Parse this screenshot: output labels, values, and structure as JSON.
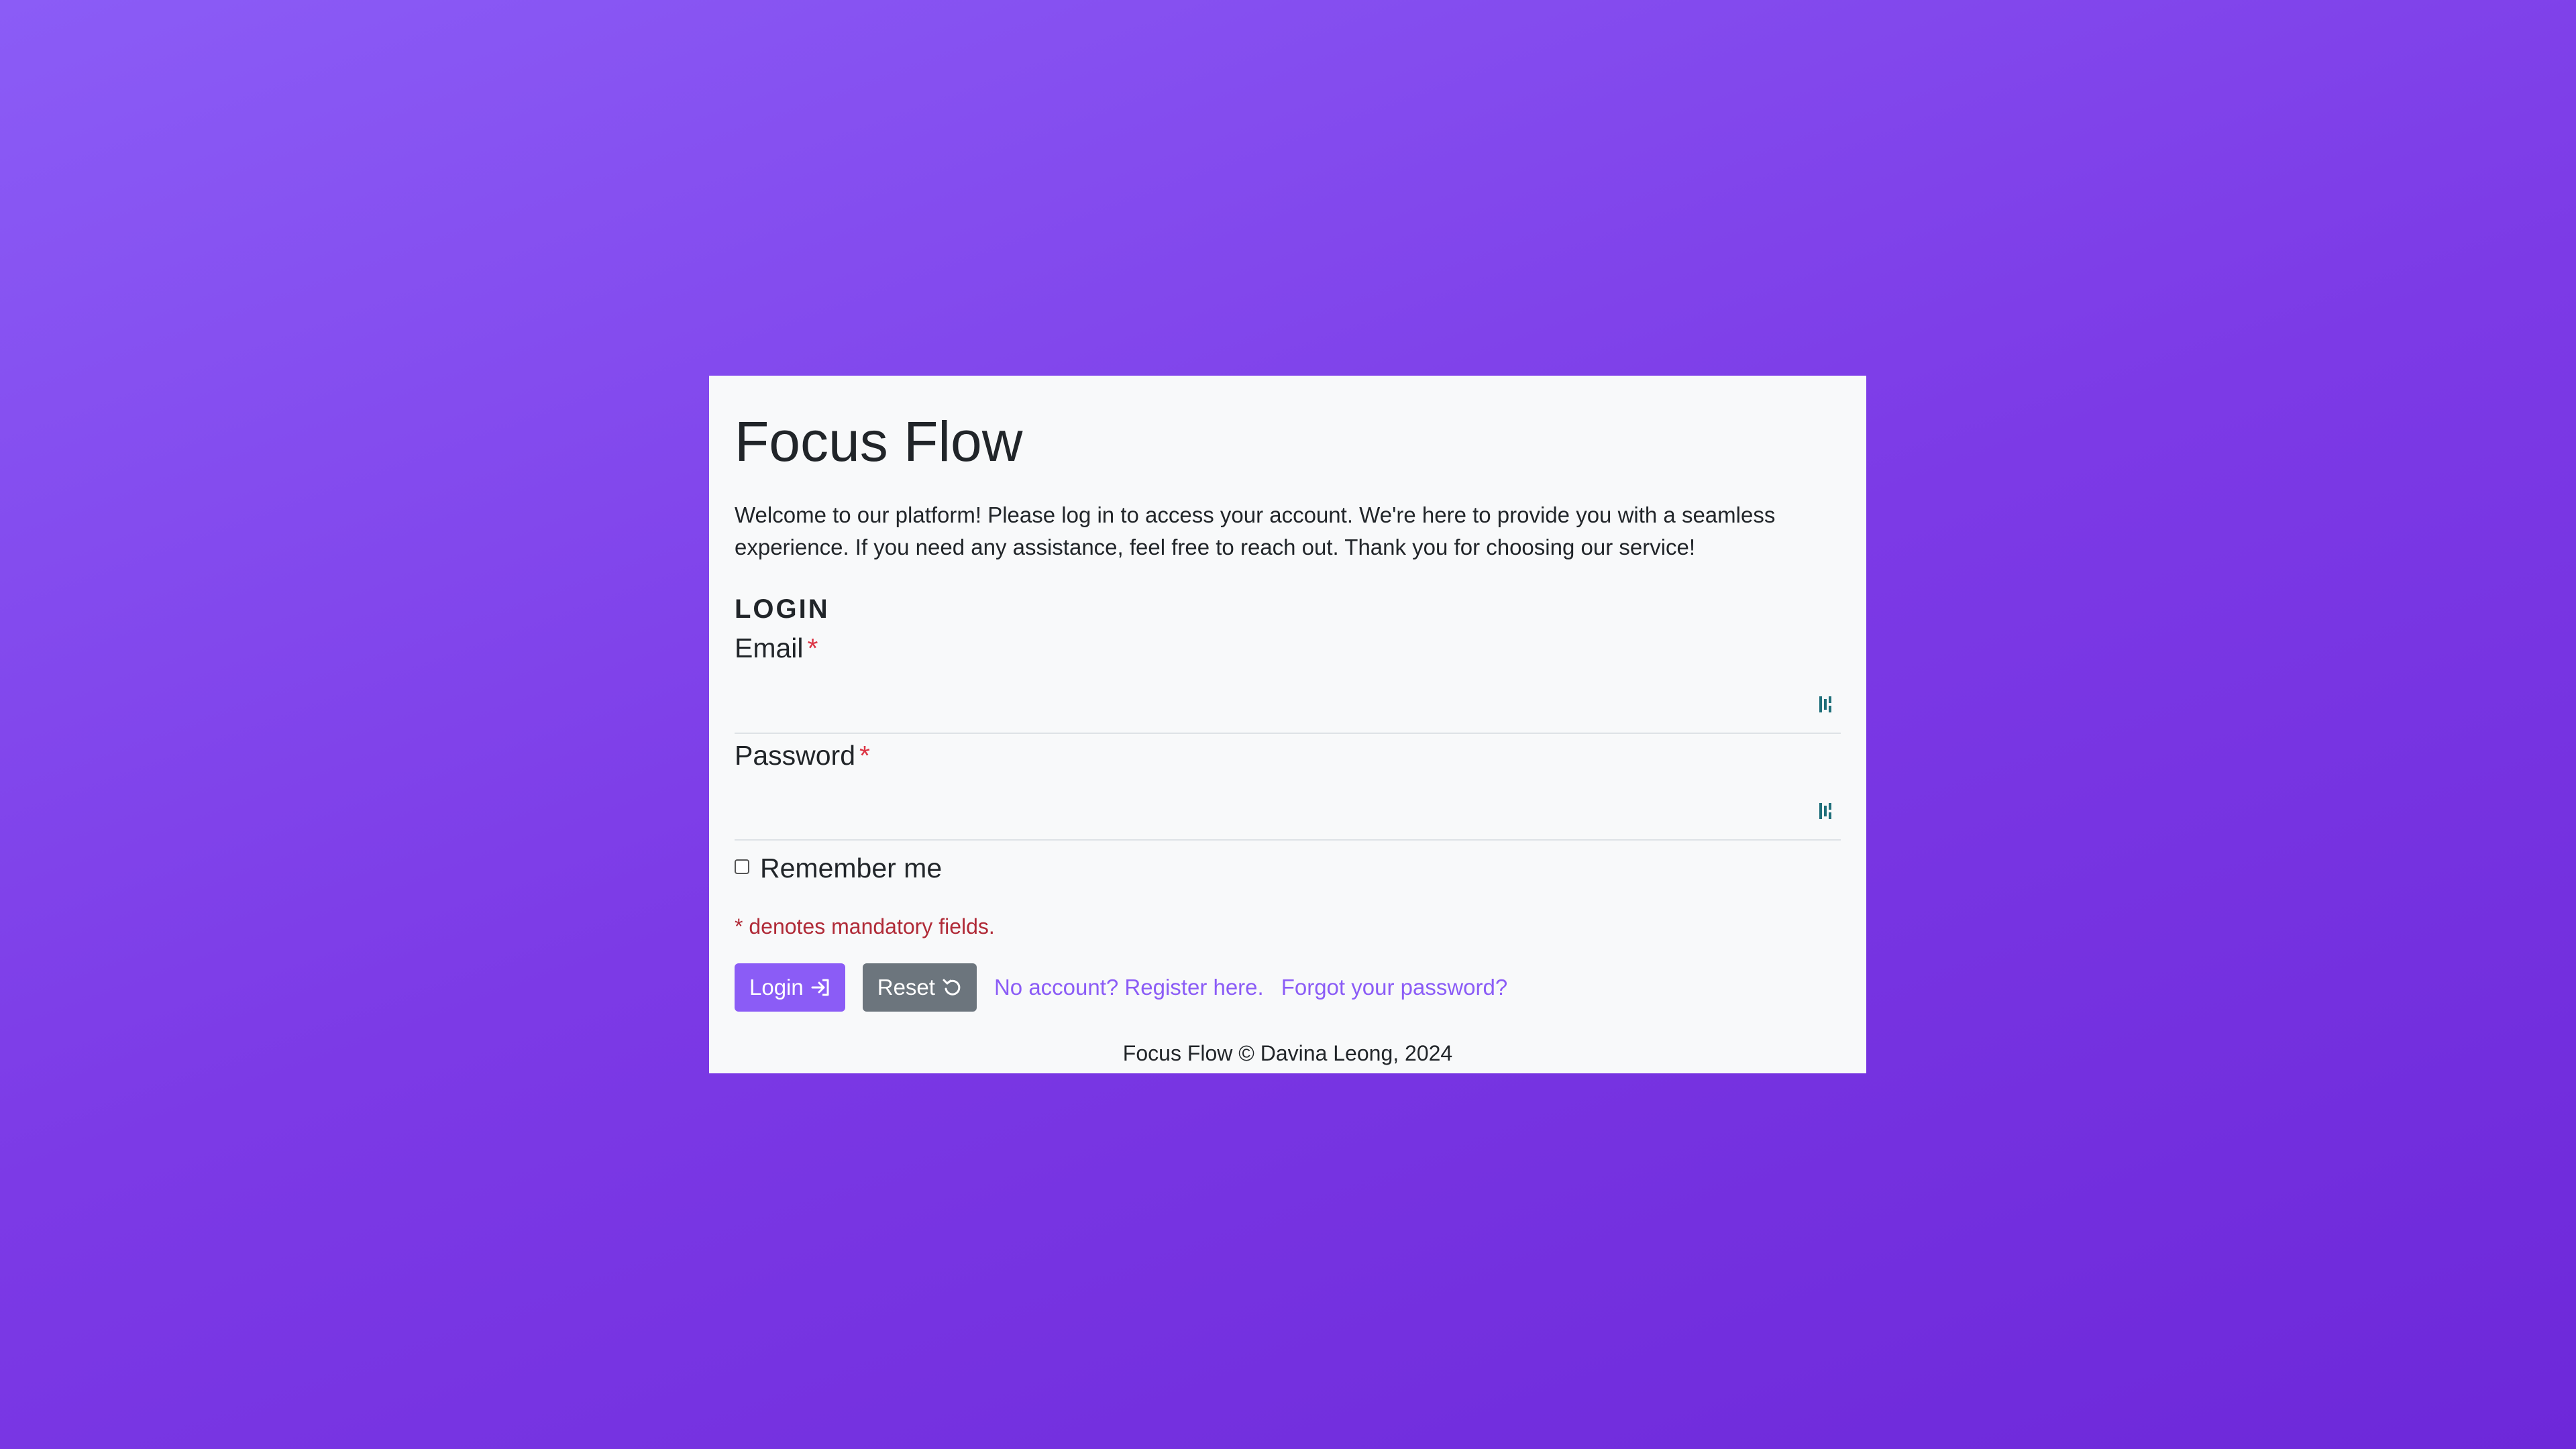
{
  "app": {
    "title": "Focus Flow",
    "welcome": "Welcome to our platform! Please log in to access your account. We're here to provide you with a seamless experience. If you need any assistance, feel free to reach out. Thank you for choosing our service!"
  },
  "form": {
    "heading": "LOGIN",
    "email_label": "Email",
    "email_value": "",
    "password_label": "Password",
    "password_value": "",
    "required_marker": "*",
    "remember_label": "Remember me",
    "remember_checked": false,
    "mandatory_note": "* denotes mandatory fields.",
    "login_button": "Login",
    "login_icon": "login-arrow-icon",
    "reset_button": "Reset",
    "reset_icon": "reset-icon",
    "register_link": "No account? Register here.",
    "forgot_link": "Forgot your password?"
  },
  "footer": {
    "text": "Focus Flow © Davina Leong, 2024"
  },
  "colors": {
    "background_top": "#8b5cf6",
    "background_bottom": "#6d28d9",
    "accent": "#8b5cf6",
    "reset_button": "#6c757d",
    "required": "#dc3545",
    "card": "#f8f9fa"
  }
}
